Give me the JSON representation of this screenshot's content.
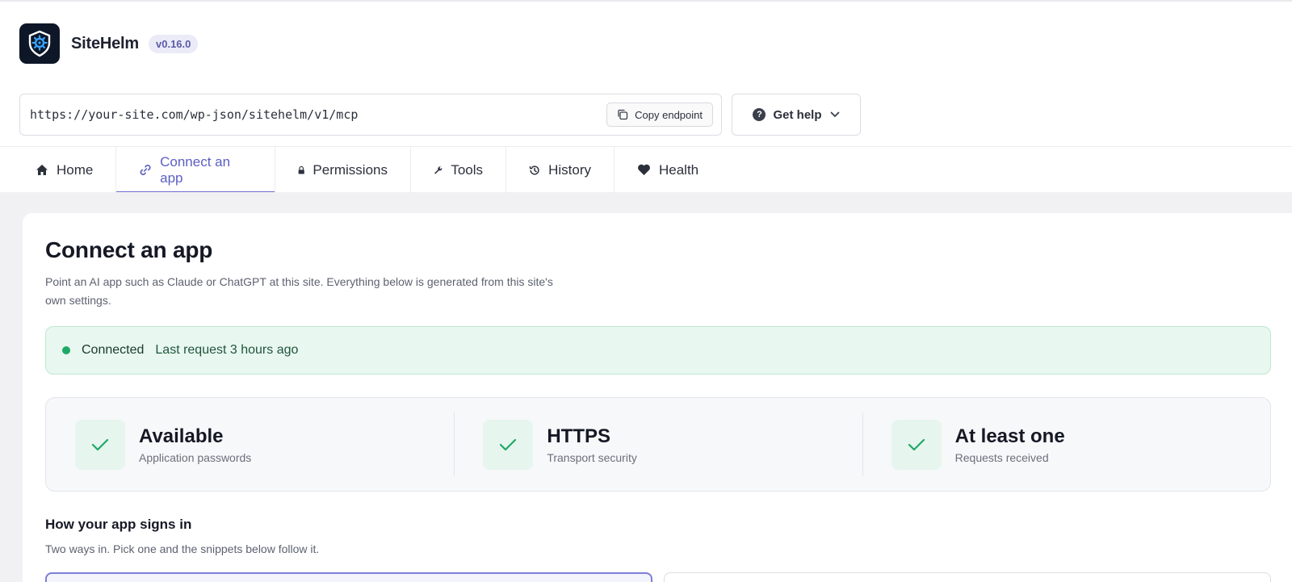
{
  "app": {
    "name": "SiteHelm",
    "version": "v0.16.0",
    "logo_icon": "shield-gear-icon"
  },
  "endpoint": {
    "url": "https://your-site.com/wp-json/sitehelm/v1/mcp",
    "copy_label": "Copy endpoint",
    "help_label": "Get help"
  },
  "tabs": [
    {
      "label": "Home",
      "icon": "home-icon",
      "active": false
    },
    {
      "label": "Connect an app",
      "icon": "link-icon",
      "active": true
    },
    {
      "label": "Permissions",
      "icon": "lock-icon",
      "active": false
    },
    {
      "label": "Tools",
      "icon": "wrench-icon",
      "active": false
    },
    {
      "label": "History",
      "icon": "history-icon",
      "active": false
    },
    {
      "label": "Health",
      "icon": "heart-icon",
      "active": false
    }
  ],
  "page": {
    "title": "Connect an app",
    "description": "Point an AI app such as Claude or ChatGPT at this site. Everything below is generated from this site's own settings."
  },
  "status": {
    "label": "Connected",
    "detail": "Last request 3 hours ago",
    "color": "#1fa866"
  },
  "checks": [
    {
      "title": "Available",
      "subtitle": "Application passwords",
      "icon": "check-icon"
    },
    {
      "title": "HTTPS",
      "subtitle": "Transport security",
      "icon": "check-icon"
    },
    {
      "title": "At least one",
      "subtitle": "Requests received",
      "icon": "check-icon"
    }
  ],
  "signin": {
    "title": "How your app signs in",
    "description": "Two ways in. Pick one and the snippets below follow it."
  },
  "colors": {
    "accent": "#5b5fc2",
    "success": "#1fa866",
    "logo_bg": "#0d1727"
  }
}
